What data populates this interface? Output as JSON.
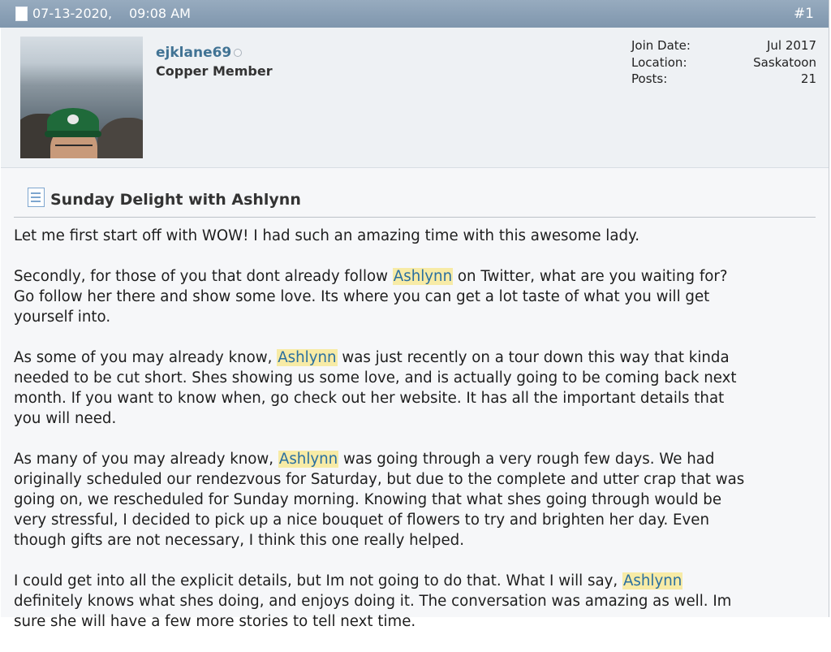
{
  "post_header": {
    "date": "07-13-2020,",
    "time": "09:08 AM",
    "post_number": "#1"
  },
  "user": {
    "username": "ejklane69",
    "title": "Copper Member",
    "stats": [
      {
        "label": "Join Date:",
        "value": "Jul 2017"
      },
      {
        "label": "Location:",
        "value": "Saskatoon"
      },
      {
        "label": "Posts:",
        "value": "21"
      }
    ]
  },
  "post": {
    "title": "Sunday Delight with Ashlynn",
    "paragraphs": [
      [
        [
          {
            "t": "Let me first start off with WOW! I had such an amazing time with this awesome lady."
          }
        ]
      ],
      [
        [
          {
            "t": "Secondly, for those of you that dont already follow "
          },
          {
            "h": "Ashlynn"
          },
          {
            "t": " on Twitter, what are you waiting for?"
          }
        ],
        [
          {
            "t": "Go follow her there and show some love. Its where you can get a lot taste of what you will get"
          }
        ],
        [
          {
            "t": "yourself into."
          }
        ]
      ],
      [
        [
          {
            "t": "As some of you may already know, "
          },
          {
            "h": "Ashlynn"
          },
          {
            "t": " was just recently on a tour down this way that kinda"
          }
        ],
        [
          {
            "t": "needed to be cut short. Shes showing us some love, and is actually going to be coming back next"
          }
        ],
        [
          {
            "t": "month. If you want to know when, go check out her website. It has all the important details that"
          }
        ],
        [
          {
            "t": "you will need."
          }
        ]
      ],
      [
        [
          {
            "t": "As many of you may already know, "
          },
          {
            "h": "Ashlynn"
          },
          {
            "t": " was going through a very rough few days. We had"
          }
        ],
        [
          {
            "t": "originally scheduled our rendezvous for Saturday, but due to the complete and utter crap that was"
          }
        ],
        [
          {
            "t": "going on, we rescheduled for Sunday morning. Knowing that what shes going through would be"
          }
        ],
        [
          {
            "t": "very stressful, I decided to pick up a nice bouquet of flowers to try and brighten her day. Even"
          }
        ],
        [
          {
            "t": "though gifts are not necessary, I think this one really helped."
          }
        ]
      ],
      [
        [
          {
            "t": "I could get into all the explicit details, but Im not going to do that. What I will say, "
          },
          {
            "h": "Ashlynn"
          }
        ],
        [
          {
            "t": "definitely knows what shes doing, and enjoys doing it. The conversation was amazing as well. Im"
          }
        ],
        [
          {
            "t": "sure she will have a few more stories to tell next time."
          }
        ]
      ]
    ]
  },
  "colors": {
    "header_bg": "#8aa0b5",
    "userinfo_bg": "#eef1f4",
    "content_bg": "#f6f7f9",
    "username": "#417394",
    "highlight_bg": "#f7eba6",
    "highlight_text": "#2a6fa0"
  },
  "icons": {
    "post_header": "document-icon",
    "post_title": "post-document-icon",
    "status": "offline-status-icon"
  }
}
